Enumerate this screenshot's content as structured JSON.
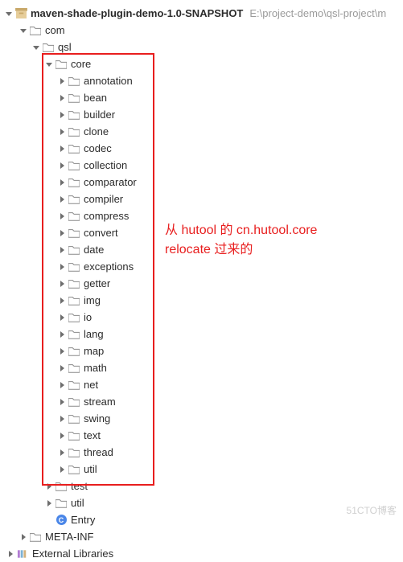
{
  "indentUnit": 16,
  "root": {
    "label": "maven-shade-plugin-demo-1.0-SNAPSHOT",
    "path": "E:\\project-demo\\qsl-project\\m",
    "arrow": "down",
    "icon": "archive",
    "indent": 0
  },
  "rows": [
    {
      "indent": 1,
      "arrow": "down",
      "icon": "folder",
      "label": "com"
    },
    {
      "indent": 2,
      "arrow": "down",
      "icon": "folder",
      "label": "qsl"
    },
    {
      "indent": 3,
      "arrow": "down",
      "icon": "folder",
      "label": "core",
      "boxed": true
    },
    {
      "indent": 4,
      "arrow": "right",
      "icon": "folder",
      "label": "annotation",
      "boxed": true
    },
    {
      "indent": 4,
      "arrow": "right",
      "icon": "folder",
      "label": "bean",
      "boxed": true
    },
    {
      "indent": 4,
      "arrow": "right",
      "icon": "folder",
      "label": "builder",
      "boxed": true
    },
    {
      "indent": 4,
      "arrow": "right",
      "icon": "folder",
      "label": "clone",
      "boxed": true
    },
    {
      "indent": 4,
      "arrow": "right",
      "icon": "folder",
      "label": "codec",
      "boxed": true
    },
    {
      "indent": 4,
      "arrow": "right",
      "icon": "folder",
      "label": "collection",
      "boxed": true
    },
    {
      "indent": 4,
      "arrow": "right",
      "icon": "folder",
      "label": "comparator",
      "boxed": true
    },
    {
      "indent": 4,
      "arrow": "right",
      "icon": "folder",
      "label": "compiler",
      "boxed": true
    },
    {
      "indent": 4,
      "arrow": "right",
      "icon": "folder",
      "label": "compress",
      "boxed": true
    },
    {
      "indent": 4,
      "arrow": "right",
      "icon": "folder",
      "label": "convert",
      "boxed": true
    },
    {
      "indent": 4,
      "arrow": "right",
      "icon": "folder",
      "label": "date",
      "boxed": true
    },
    {
      "indent": 4,
      "arrow": "right",
      "icon": "folder",
      "label": "exceptions",
      "boxed": true
    },
    {
      "indent": 4,
      "arrow": "right",
      "icon": "folder",
      "label": "getter",
      "boxed": true
    },
    {
      "indent": 4,
      "arrow": "right",
      "icon": "folder",
      "label": "img",
      "boxed": true
    },
    {
      "indent": 4,
      "arrow": "right",
      "icon": "folder",
      "label": "io",
      "boxed": true
    },
    {
      "indent": 4,
      "arrow": "right",
      "icon": "folder",
      "label": "lang",
      "boxed": true
    },
    {
      "indent": 4,
      "arrow": "right",
      "icon": "folder",
      "label": "map",
      "boxed": true
    },
    {
      "indent": 4,
      "arrow": "right",
      "icon": "folder",
      "label": "math",
      "boxed": true
    },
    {
      "indent": 4,
      "arrow": "right",
      "icon": "folder",
      "label": "net",
      "boxed": true
    },
    {
      "indent": 4,
      "arrow": "right",
      "icon": "folder",
      "label": "stream",
      "boxed": true
    },
    {
      "indent": 4,
      "arrow": "right",
      "icon": "folder",
      "label": "swing",
      "boxed": true
    },
    {
      "indent": 4,
      "arrow": "right",
      "icon": "folder",
      "label": "text",
      "boxed": true
    },
    {
      "indent": 4,
      "arrow": "right",
      "icon": "folder",
      "label": "thread",
      "boxed": true
    },
    {
      "indent": 4,
      "arrow": "right",
      "icon": "folder",
      "label": "util",
      "boxed": true
    },
    {
      "indent": 3,
      "arrow": "right",
      "icon": "folder",
      "label": "test"
    },
    {
      "indent": 3,
      "arrow": "right",
      "icon": "folder",
      "label": "util"
    },
    {
      "indent": 3,
      "arrow": "none",
      "icon": "class",
      "label": "Entry"
    },
    {
      "indent": 1,
      "arrow": "right",
      "icon": "folder",
      "label": "META-INF"
    },
    {
      "indent": 0,
      "arrow": "right",
      "icon": "library",
      "label": "External Libraries"
    }
  ],
  "annotation": {
    "line1": "从 hutool 的 cn.hutool.core",
    "line2": "relocate 过来的"
  },
  "watermark": "51CTO博客",
  "classGlyph": "C"
}
